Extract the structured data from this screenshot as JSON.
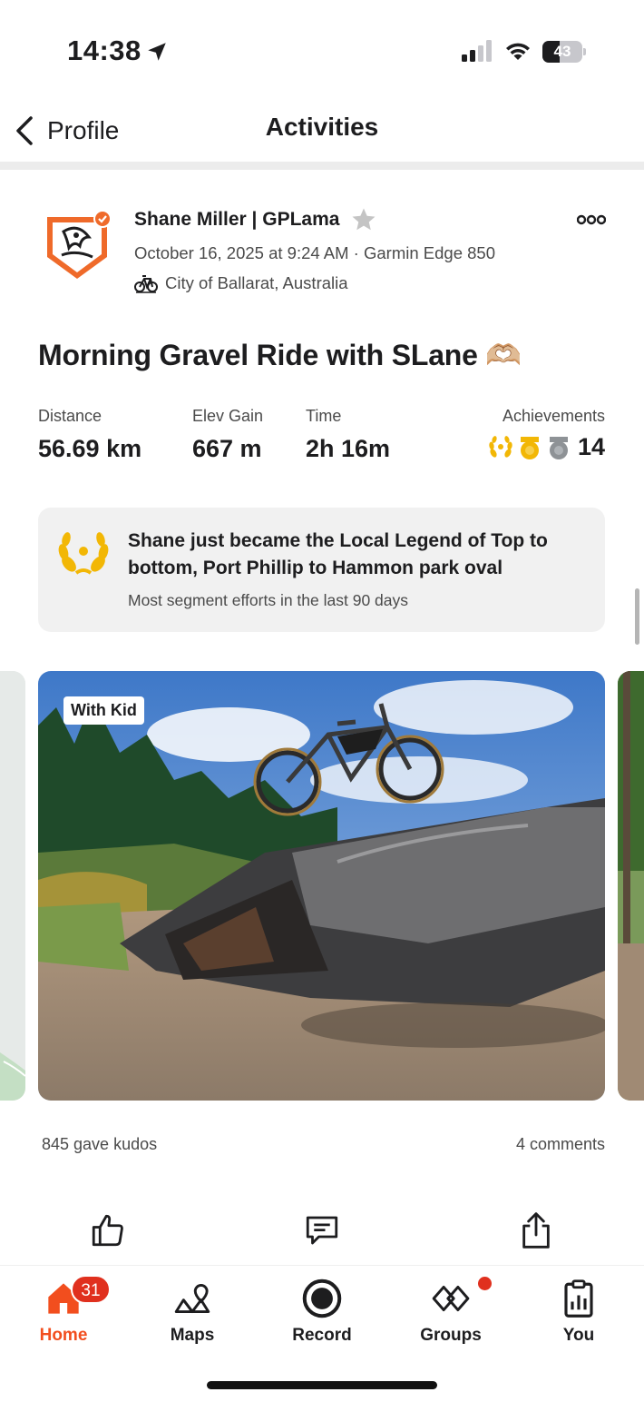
{
  "status_bar": {
    "time": "14:38",
    "battery": "43",
    "battery_level": 0.43
  },
  "nav": {
    "back_label": "Profile",
    "title": "Activities"
  },
  "activity": {
    "athlete_name": "Shane Miller | GPLama",
    "meta": "October 16, 2025 at 9:24 AM · Garmin Edge 850",
    "location": "City of Ballarat, Australia",
    "title": "Morning Gravel Ride with SLane 🫶🏼",
    "stats": [
      {
        "label": "Distance",
        "value": "56.69 km"
      },
      {
        "label": "Elev Gain",
        "value": "667 m"
      },
      {
        "label": "Time",
        "value": "2h 16m"
      }
    ],
    "achievements": {
      "label": "Achievements",
      "count": "14"
    }
  },
  "legend_card": {
    "title": "Shane just became the Local Legend of Top to bottom, Port Phillip to Hammon park oval",
    "subtitle": "Most segment efforts in the last 90 days"
  },
  "media": {
    "photo_tag": "With Kid"
  },
  "social": {
    "kudos": "845 gave kudos",
    "comments": "4 comments"
  },
  "tabs": [
    {
      "label": "Home",
      "icon": "home-icon",
      "badge": "31",
      "active": true
    },
    {
      "label": "Maps",
      "icon": "maps-icon"
    },
    {
      "label": "Record",
      "icon": "record-icon"
    },
    {
      "label": "Groups",
      "icon": "groups-icon",
      "dot": true
    },
    {
      "label": "You",
      "icon": "you-icon"
    }
  ],
  "colors": {
    "brand": "#f24e1e",
    "badge": "#e0301e",
    "gold": "#f2b705",
    "silver": "#8e9296"
  }
}
